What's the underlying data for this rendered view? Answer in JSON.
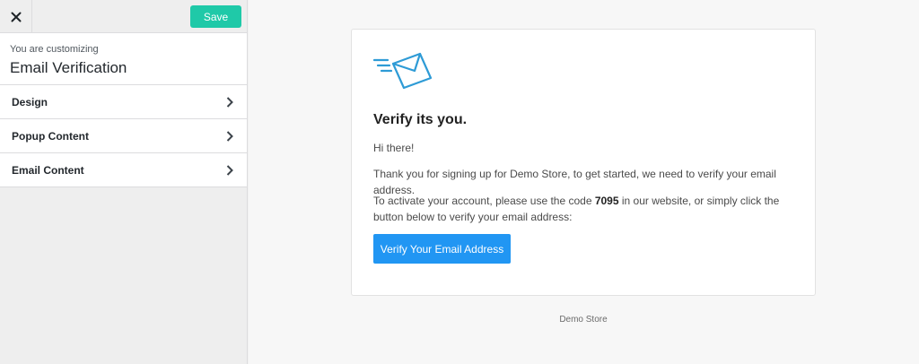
{
  "sidebar": {
    "close_icon": "close-icon",
    "save_label": "Save",
    "customizing_label": "You are customizing",
    "customizing_title": "Email Verification",
    "sections": [
      {
        "label": "Design",
        "icon": "chevron-right-icon"
      },
      {
        "label": "Popup Content",
        "icon": "chevron-right-icon"
      },
      {
        "label": "Email Content",
        "icon": "chevron-right-icon"
      }
    ]
  },
  "email": {
    "icon": "envelope-icon",
    "title": "Verify its you.",
    "greeting": "Hi there!",
    "body1": "Thank you for signing up for Demo Store, to get started, we need to verify your email address.",
    "body2_prefix": "To activate your account, please use the code ",
    "code": "7095",
    "body2_suffix": " in our website, or simply click the button below to verify your email address:",
    "button_label": "Verify Your Email Address",
    "footer": "Demo Store"
  },
  "colors": {
    "save_button": "#1fc9a8",
    "verify_button": "#2196f3",
    "envelope": "#2e9bd6"
  }
}
